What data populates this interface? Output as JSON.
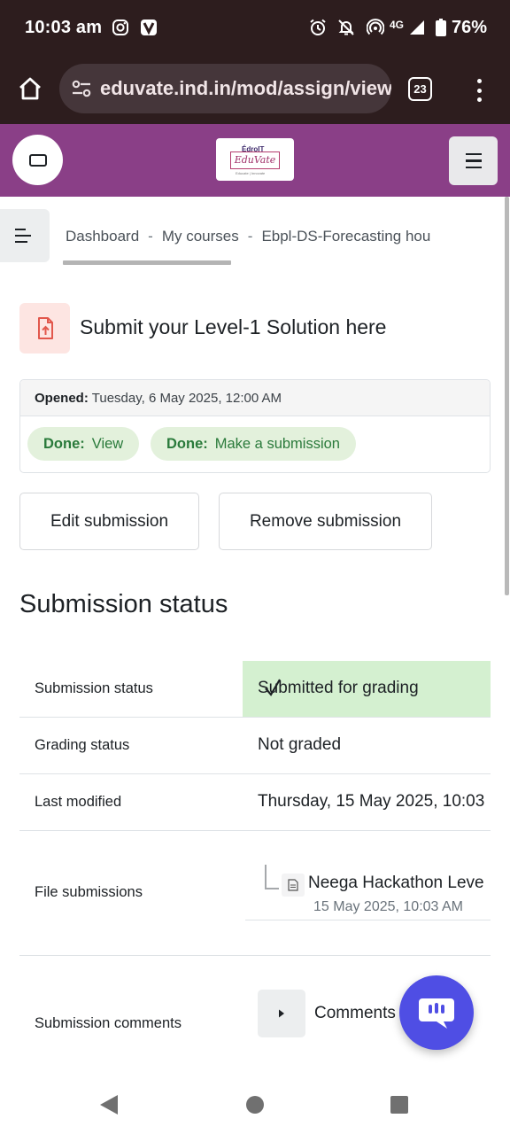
{
  "status_bar": {
    "time": "10:03 am",
    "network": "4G",
    "battery": "76%",
    "icons": [
      "instagram-icon",
      "vivaldi-icon",
      "alarm-icon",
      "notifications-off-icon",
      "hotspot-icon",
      "signal-icon",
      "battery-icon"
    ]
  },
  "browser": {
    "url": "eduvate.ind.in/mod/assign/view",
    "tab_count": "23"
  },
  "site_header": {
    "logo_top": "ÉdroIT",
    "logo_main": "EduVate",
    "logo_sub": "Educate | Innovate"
  },
  "breadcrumb": {
    "items": [
      "Dashboard",
      "My courses",
      "Ebpl-DS-Forecasting hou"
    ],
    "separator": "-"
  },
  "page": {
    "title": "Submit your Level-1 Solution here"
  },
  "dates": {
    "opened_label": "Opened:",
    "opened_value": "Tuesday, 6 May 2025, 12:00 AM"
  },
  "completion": [
    {
      "status": "Done:",
      "label": "View"
    },
    {
      "status": "Done:",
      "label": "Make a submission"
    }
  ],
  "actions": {
    "edit": "Edit submission",
    "remove": "Remove submission"
  },
  "submission_status": {
    "heading": "Submission status",
    "rows": [
      {
        "label": "Submission status",
        "value": "Submitted for grading"
      },
      {
        "label": "Grading status",
        "value": "Not graded"
      },
      {
        "label": "Last modified",
        "value": "Thursday, 15 May 2025, 10:03"
      },
      {
        "label": "File submissions",
        "value": ""
      },
      {
        "label": "Submission comments",
        "value": ""
      }
    ],
    "file": {
      "name": "Neega Hackathon Leve",
      "date": "15 May 2025, 10:03 AM"
    },
    "comments_label": "Comments"
  },
  "colors": {
    "header": "#8a3f87",
    "chrome": "#2d1d1e",
    "status_submitted": "#d4f0d0",
    "badge_done": "#e3f1dc",
    "fab": "#4f4ee4"
  }
}
